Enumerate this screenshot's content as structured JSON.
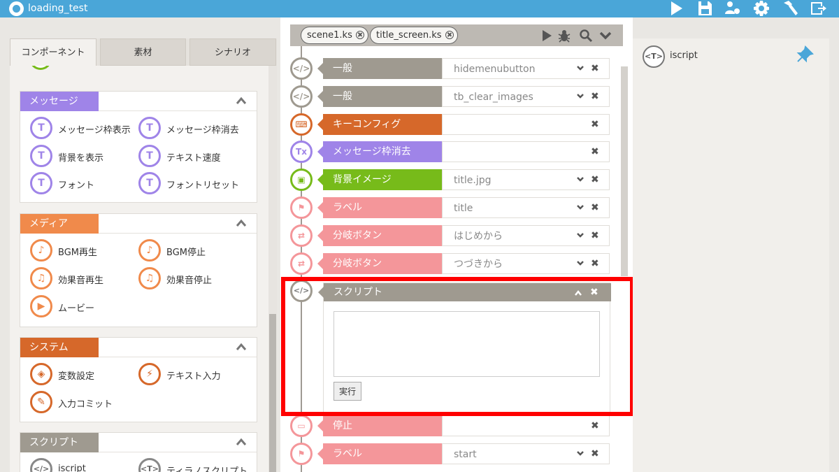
{
  "app": {
    "title": "loading_test"
  },
  "toolbar": {
    "icons": [
      "play-icon",
      "save-icon",
      "users-gear-icon",
      "gear-icon",
      "hammer-icon",
      "export-icon"
    ]
  },
  "left": {
    "tabs": [
      "コンポーネント",
      "素材",
      "シナリオ"
    ],
    "sections": [
      {
        "title": "メッセージ",
        "color": "#9f84e8",
        "items": [
          "メッセージ枠表示",
          "メッセージ枠消去",
          "背景を表示",
          "テキスト速度",
          "フォント",
          "フォントリセット"
        ]
      },
      {
        "title": "メディア",
        "color": "#f08a4b",
        "items": [
          "BGM再生",
          "BGM停止",
          "効果音再生",
          "効果音停止",
          "ムービー"
        ]
      },
      {
        "title": "システム",
        "color": "#d6682a",
        "items": [
          "変数設定",
          "テキスト入力",
          "入力コミット"
        ]
      },
      {
        "title": "スクリプト",
        "color": "#9f9a90",
        "items": [
          "iscript",
          "ティラノスクリプト"
        ]
      }
    ]
  },
  "scenes": {
    "tabs": [
      "scene1.ks",
      "title_screen.ks"
    ]
  },
  "rows": [
    {
      "category": "一般",
      "value": "hidemenubutton",
      "color": "#9f9a90",
      "icon": "</>"
    },
    {
      "category": "一般",
      "value": "tb_clear_images",
      "color": "#9f9a90",
      "icon": "</>"
    },
    {
      "category": "キーコンフィグ",
      "value": "",
      "color": "#d6682a",
      "icon": "⌨"
    },
    {
      "category": "メッセージ枠消去",
      "value": "",
      "color": "#9f84e8",
      "icon": "Tx"
    },
    {
      "category": "背景イメージ",
      "value": "title.jpg",
      "color": "#77bb1a",
      "icon": "▣"
    },
    {
      "category": "ラベル",
      "value": "title",
      "color": "#f4969a",
      "icon": "⚑"
    },
    {
      "category": "分岐ボタン",
      "value": "はじめから",
      "color": "#f4969a",
      "icon": "⇄"
    },
    {
      "category": "分岐ボタン",
      "value": "つづきから",
      "color": "#f4969a",
      "icon": "⇄"
    }
  ],
  "script_block": {
    "title": "スクリプト",
    "run_label": "実行",
    "text": ""
  },
  "rows_after": [
    {
      "category": "停止",
      "value": "",
      "color": "#f4969a",
      "icon": "▭"
    },
    {
      "category": "ラベル",
      "value": "start",
      "color": "#f4969a",
      "icon": "⚑"
    }
  ],
  "right": {
    "label": "iscript",
    "icon_text": "<T>"
  },
  "palette": {
    "accent": "#4aa6d8",
    "highlight": "#ff0000"
  }
}
